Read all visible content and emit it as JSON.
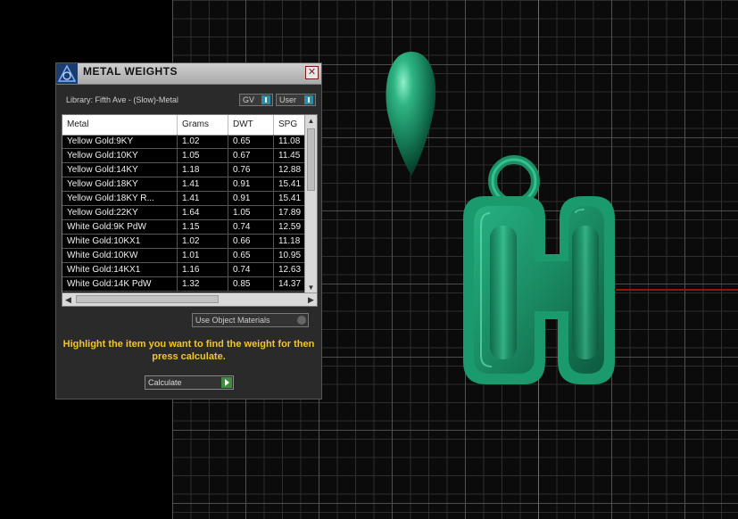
{
  "dialog": {
    "title": "METAL WEIGHTS",
    "close_glyph": "✕",
    "library_label": "Library: Fifth Ave - (Slow)-Metal",
    "toggle_gv": "GV",
    "toggle_user": "User",
    "columns": [
      "Metal",
      "Grams",
      "DWT",
      "SPG"
    ],
    "rows": [
      [
        "Yellow Gold:9KY",
        "1.02",
        "0.65",
        "11.08"
      ],
      [
        "Yellow Gold:10KY",
        "1.05",
        "0.67",
        "11.45"
      ],
      [
        "Yellow Gold:14KY",
        "1.18",
        "0.76",
        "12.88"
      ],
      [
        "Yellow Gold:18KY",
        "1.41",
        "0.91",
        "15.41"
      ],
      [
        "Yellow Gold:18KY R...",
        "1.41",
        "0.91",
        "15.41"
      ],
      [
        "Yellow Gold:22KY",
        "1.64",
        "1.05",
        "17.89"
      ],
      [
        "White Gold:9K PdW",
        "1.15",
        "0.74",
        "12.59"
      ],
      [
        "White Gold:10KX1",
        "1.02",
        "0.66",
        "11.18"
      ],
      [
        "White Gold:10KW",
        "1.01",
        "0.65",
        "10.95"
      ],
      [
        "White Gold:14KX1",
        "1.16",
        "0.74",
        "12.63"
      ],
      [
        "White Gold:14K PdW",
        "1.32",
        "0.85",
        "14.37"
      ]
    ],
    "use_object_materials": "Use Object Materials",
    "hint": "Highlight the item you want to find the weight for then press calculate.",
    "calculate_label": "Calculate"
  },
  "icons": {
    "title_logo": "app-logo-icon",
    "scroll_up": "▲",
    "scroll_down": "▼",
    "scroll_left": "◀",
    "scroll_right": "▶"
  },
  "colors": {
    "hint": "#f2c430",
    "model": "#1f9a6f",
    "axis_y": "#1c8f8f",
    "axis_x": "#9b1010"
  }
}
